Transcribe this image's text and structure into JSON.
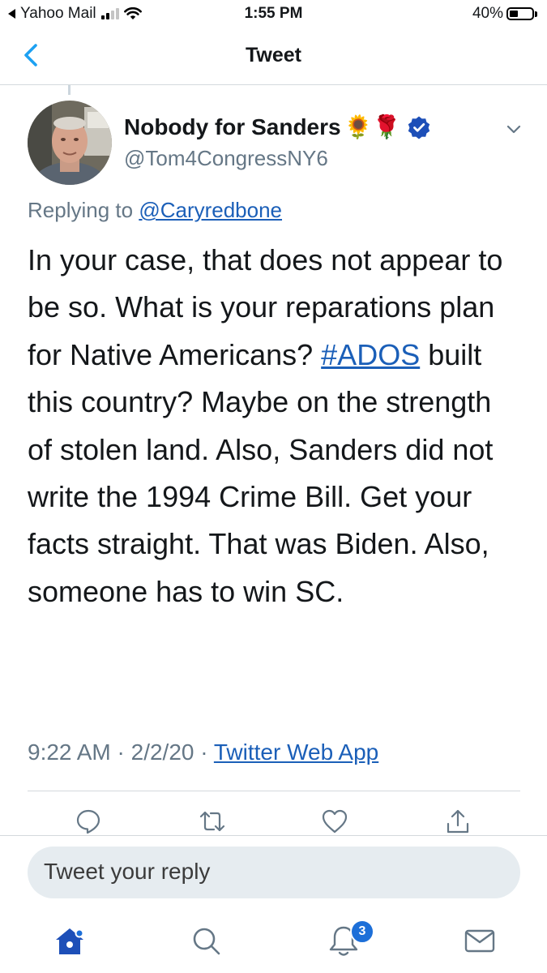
{
  "status_bar": {
    "back_app": "Yahoo Mail",
    "time": "1:55 PM",
    "battery_percent": "40%",
    "battery_level": 0.4,
    "signal_bars": 2
  },
  "nav": {
    "title": "Tweet",
    "back_icon": "chevron-left-icon"
  },
  "tweet": {
    "display_name": "Nobody for Sanders",
    "name_emojis": "🌻🌹",
    "verified_icon": "verified-badge-icon",
    "handle": "@Tom4CongressNY6",
    "replying_to_label": "Replying to",
    "replying_to_handle": "@Caryredbone",
    "text_before_hashtag": "In your case, that does not appear to be so. What is your reparations plan for Native Americans? ",
    "hashtag": "#ADOS",
    "text_after_hashtag": " built this country? Maybe on the strength of stolen land. Also, Sanders did not write the 1994 Crime Bill. Get your facts straight. That was Biden. Also, someone has to win SC.",
    "time": "9:22 AM",
    "date": "2/2/20",
    "separator": "·",
    "source": "Twitter Web App"
  },
  "actions": [
    "comment-icon",
    "retweet-icon",
    "like-icon",
    "share-icon"
  ],
  "reply_box": {
    "placeholder": "Tweet your reply"
  },
  "tab_bar": {
    "tabs": [
      "home-icon",
      "search-icon",
      "notifications-icon",
      "messages-icon"
    ],
    "notifications_badge": "3"
  },
  "colors": {
    "accent": "#1b5fb8",
    "badge": "#1d6fd8",
    "muted": "#657786",
    "reply_bg": "#e6ecf0"
  }
}
